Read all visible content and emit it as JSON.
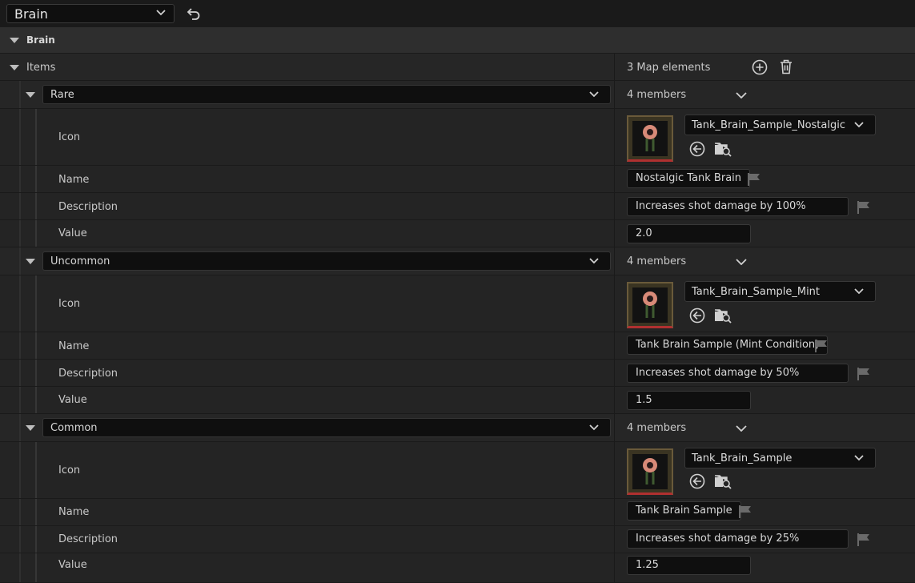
{
  "top": {
    "dropdown_value": "Brain"
  },
  "section": {
    "title": "Brain"
  },
  "items": {
    "label": "Items",
    "count_text": "3 Map elements"
  },
  "members_text": "4 members",
  "field_labels": {
    "icon": "Icon",
    "name": "Name",
    "description": "Description",
    "value": "Value"
  },
  "entries": [
    {
      "key": "Rare",
      "asset": "Tank_Brain_Sample_Nostalgic",
      "name": "Nostalgic Tank Brain",
      "description": "Increases shot damage by 100%",
      "value": "2.0"
    },
    {
      "key": "Uncommon",
      "asset": "Tank_Brain_Sample_Mint",
      "name": "Tank Brain Sample (Mint Condition)",
      "description": "Increases shot damage by 50%",
      "value": "1.5"
    },
    {
      "key": "Common",
      "asset": "Tank_Brain_Sample",
      "name": "Tank Brain Sample",
      "description": "Increases shot damage by 25%",
      "value": "1.25"
    }
  ],
  "icons": [
    "chevron-down-icon",
    "undo-icon",
    "collapse-triangle-icon",
    "add-circle-icon",
    "trash-icon",
    "browse-back-icon",
    "find-in-browser-icon",
    "flag-icon"
  ]
}
